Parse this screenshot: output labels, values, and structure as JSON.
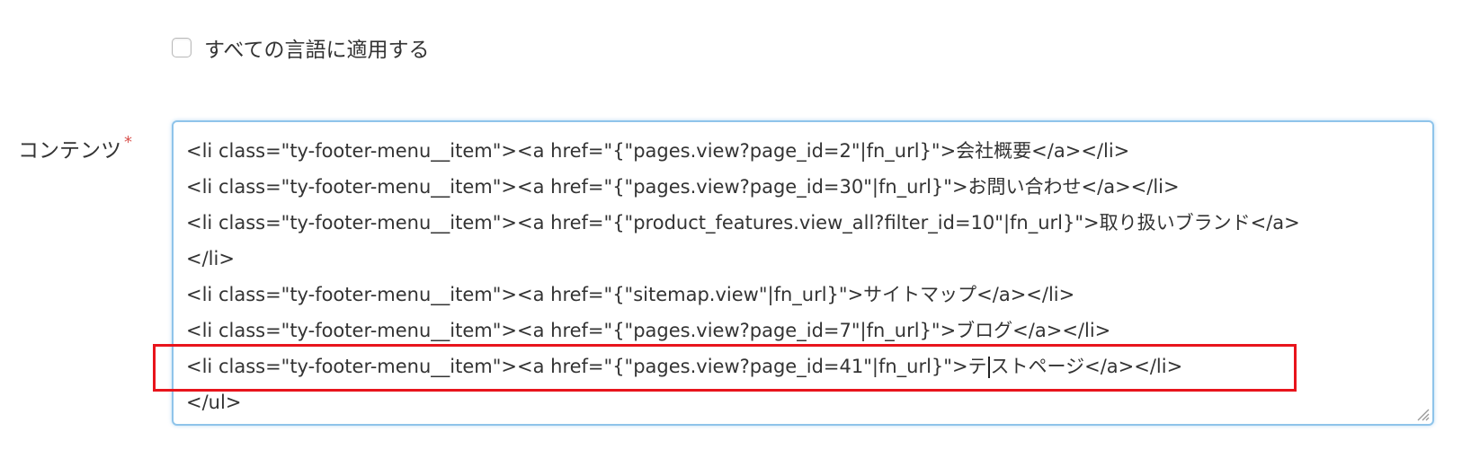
{
  "apply_all_languages": {
    "label": "すべての言語に適用する",
    "checked": false
  },
  "content_field": {
    "label": "コンテンツ",
    "required_mark": "*",
    "lines": [
      "<li class=\"ty-footer-menu__item\"><a href=\"{\"pages.view?page_id=2\"|fn_url}\">会社概要</a></li>",
      "<li class=\"ty-footer-menu__item\"><a href=\"{\"pages.view?page_id=30\"|fn_url}\">お問い合わせ</a></li>",
      "<li class=\"ty-footer-menu__item\"><a href=\"{\"product_features.view_all?filter_id=10\"|fn_url}\">取り扱いブランド</a>",
      "</li>",
      "<li class=\"ty-footer-menu__item\"><a href=\"{\"sitemap.view\"|fn_url}\">サイトマップ</a></li>",
      "<li class=\"ty-footer-menu__item\"><a href=\"{\"pages.view?page_id=7\"|fn_url}\">ブログ</a></li>"
    ],
    "highlighted_line_before_caret": "<li class=\"ty-footer-menu__item\"><a href=\"{\"pages.view?page_id=41\"|fn_url}\">テ",
    "highlighted_line_after_caret": "ストページ</a></li>",
    "closing_line": "</ul>"
  },
  "colors": {
    "highlight_border": "#e8141c",
    "focus_border": "#8fc4ea",
    "required": "#d9534f"
  }
}
